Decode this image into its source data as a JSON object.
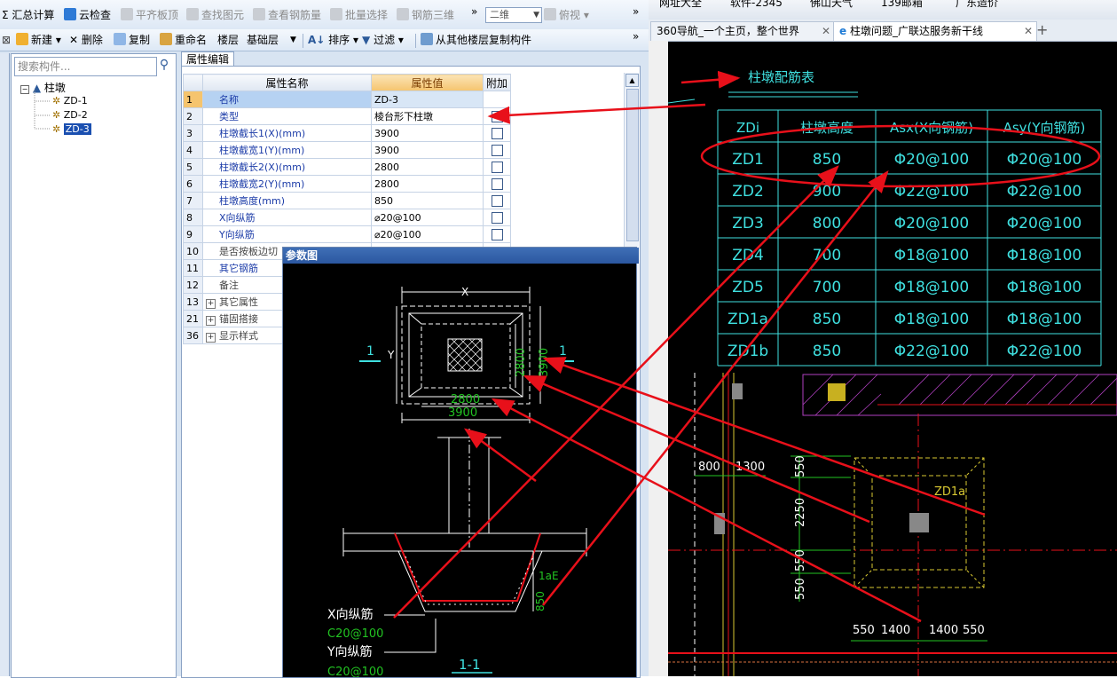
{
  "toolbar": {
    "items": [
      {
        "label": "Σ 汇总计算",
        "disabled": false
      },
      {
        "label": "云检查",
        "disabled": false
      },
      {
        "label": "平齐板顶",
        "disabled": true
      },
      {
        "label": "查找图元",
        "disabled": true
      },
      {
        "label": "查看钢筋量",
        "disabled": true
      },
      {
        "label": "批量选择",
        "disabled": true
      },
      {
        "label": "钢筋三维",
        "disabled": true
      }
    ],
    "view_combo": "二维",
    "view_mode": "俯视",
    "more": "»"
  },
  "toolbar2": {
    "new": "新建",
    "delete": "删除",
    "copy": "复制",
    "rename": "重命名",
    "floor_label": "楼层",
    "floor_value": "基础层",
    "sort": "排序",
    "filter": "过滤",
    "copy_from_floor": "从其他楼层复制构件",
    "more": "»"
  },
  "tree": {
    "search_placeholder": "搜索构件...",
    "root": "柱墩",
    "children": [
      "ZD-1",
      "ZD-2",
      "ZD-3"
    ],
    "selected": "ZD-3"
  },
  "grid": {
    "tab": "属性编辑",
    "headers": [
      "属性名称",
      "属性值",
      "附加"
    ],
    "rows": [
      {
        "n": "1",
        "name": "名称",
        "value": "ZD-3",
        "check": false
      },
      {
        "n": "2",
        "name": "类型",
        "value": "棱台形下柱墩",
        "check": true
      },
      {
        "n": "3",
        "name": "柱墩截长1(X)(mm)",
        "value": "3900",
        "check": true
      },
      {
        "n": "4",
        "name": "柱墩截宽1(Y)(mm)",
        "value": "3900",
        "check": true
      },
      {
        "n": "5",
        "name": "柱墩截长2(X)(mm)",
        "value": "2800",
        "check": true
      },
      {
        "n": "6",
        "name": "柱墩截宽2(Y)(mm)",
        "value": "2800",
        "check": true
      },
      {
        "n": "7",
        "name": "柱墩高度(mm)",
        "value": "850",
        "check": true
      },
      {
        "n": "8",
        "name": "X向纵筋",
        "value": "⌀20@100",
        "check": true
      },
      {
        "n": "9",
        "name": "Y向纵筋",
        "value": "⌀20@100",
        "check": true
      },
      {
        "n": "10",
        "name": "是否按板边切",
        "value": "",
        "check": false
      },
      {
        "n": "11",
        "name": "其它钢筋",
        "value": "",
        "check": false
      },
      {
        "n": "12",
        "name": "备注",
        "value": "",
        "check": false
      },
      {
        "n": "13",
        "name": "其它属性",
        "value": "",
        "check": false
      },
      {
        "n": "21",
        "name": "锚固搭接",
        "value": "",
        "check": false
      },
      {
        "n": "36",
        "name": "显示样式",
        "value": "",
        "check": false
      }
    ]
  },
  "param": {
    "title": "参数图",
    "x_label": "X",
    "y_label": "Y",
    "sec_left": "1",
    "sec_right": "1",
    "dim_2800_h": "2800",
    "dim_3900_h": "3900",
    "dim_2800_v": "2800",
    "dim_3900_v": "3900",
    "lae": "1aE",
    "h850": "850",
    "x_bar": "X向纵筋",
    "x_bar_val": "C20@100",
    "y_bar": "Y向纵筋",
    "y_bar_val": "C20@100",
    "section": "1-1"
  },
  "browser": {
    "bookmarks": [
      "网址大全",
      "软件-2345",
      "佛山天气",
      "139邮箱",
      "广东造价"
    ],
    "tabs": [
      "360导航_一个主页，整个世界",
      "柱墩问题_广联达服务新干线"
    ],
    "new_tab": "+"
  },
  "cad": {
    "title": "柱墩配筋表",
    "headers": [
      "ZDi",
      "柱墩高度",
      "Asx(X向钢筋)",
      "Asy(Y向钢筋)"
    ],
    "rows": [
      [
        "ZD1",
        "850",
        "Φ20@100",
        "Φ20@100"
      ],
      [
        "ZD2",
        "900",
        "Φ22@100",
        "Φ22@100"
      ],
      [
        "ZD3",
        "800",
        "Φ20@100",
        "Φ20@100"
      ],
      [
        "ZD4",
        "700",
        "Φ18@100",
        "Φ18@100"
      ],
      [
        "ZD5",
        "700",
        "Φ18@100",
        "Φ18@100"
      ],
      [
        "ZD1a",
        "850",
        "Φ18@100",
        "Φ18@100"
      ],
      [
        "ZD1b",
        "850",
        "Φ22@100",
        "Φ22@100"
      ]
    ],
    "dims_h_top": [
      "800",
      "1300"
    ],
    "dims_v": [
      "550",
      "2250",
      "550",
      "550"
    ],
    "dims_h_bottom": [
      "550",
      "1400",
      "1400",
      "550"
    ],
    "zd_label": "ZD1a"
  },
  "colors": {
    "annotation_arrow": "#e8101a",
    "cad_cyan": "#3fe0e0",
    "cad_green": "#22c322",
    "cad_yellow": "#d8c832",
    "cad_magenta": "#b040c0"
  }
}
